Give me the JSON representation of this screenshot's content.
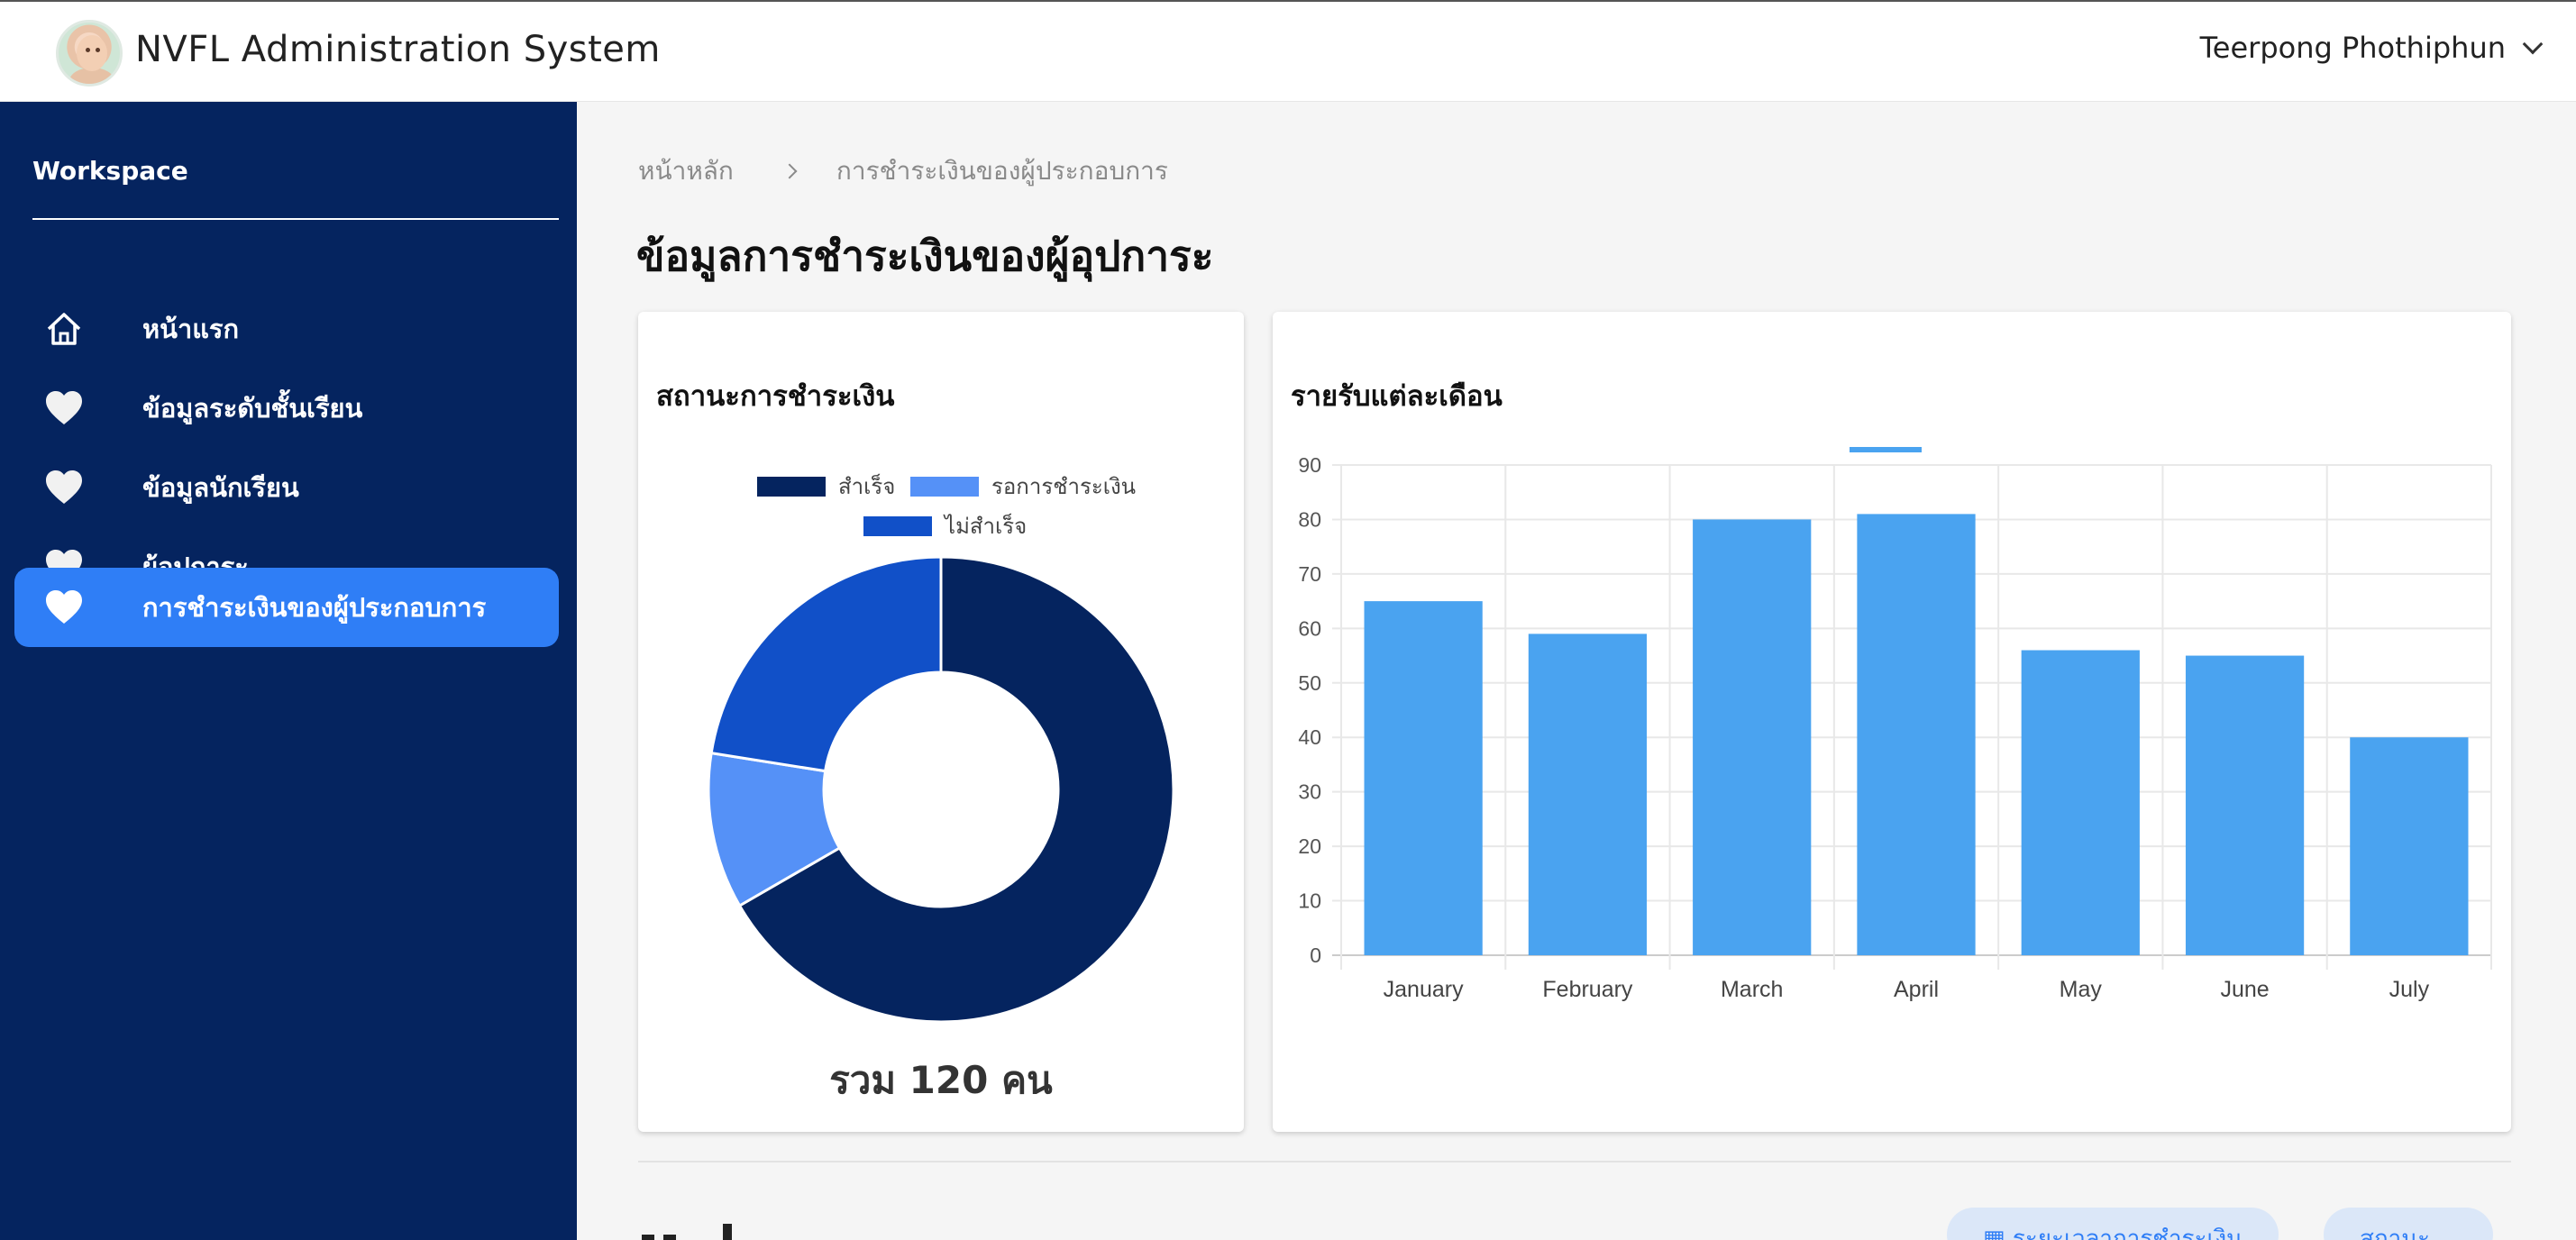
{
  "header": {
    "app_title": "NVFL Administration System",
    "user_name": "Teerpong Phothiphun"
  },
  "sidebar": {
    "workspace_label": "Workspace",
    "items": [
      {
        "label": "หน้าแรก",
        "icon": "home-icon",
        "active": false
      },
      {
        "label": "ข้อมูลระดับชั้นเรียน",
        "icon": "heart-icon",
        "active": false
      },
      {
        "label": "ข้อมูลนักเรียน",
        "icon": "heart-icon",
        "active": false
      },
      {
        "label": "ผู้อุปการะ",
        "icon": "heart-icon",
        "active": false
      },
      {
        "label": "การชำระเงินของผู้ประกอบการ",
        "icon": "heart-icon",
        "active": true
      }
    ],
    "colors": {
      "background": "#05245f",
      "active": "#2f7ef6"
    }
  },
  "breadcrumb": {
    "home": "หน้าหลัก",
    "current": "การชำระเงินของผู้ประกอบการ"
  },
  "page": {
    "title": "ข้อมูลการชำระเงินของผู้อุปการะ"
  },
  "status_card": {
    "title": "สถานะการชำระเงิน",
    "total_label": "รวม 120 คน"
  },
  "revenue_card": {
    "title": "รายรับแต่ละเดือน"
  },
  "bottom_pills": {
    "first": "ระยะเวลาการชำระเงิน",
    "second": "สถานะ"
  },
  "chart_data": [
    {
      "type": "pie",
      "variant": "doughnut",
      "labels": [
        "สำเร็จ",
        "รอการชำระเงิน",
        "ไม่สำเร็จ"
      ],
      "values": [
        80,
        13,
        27
      ],
      "colors": [
        "#05245f",
        "#5591f7",
        "#1150c8"
      ],
      "legend": "top"
    },
    {
      "type": "bar",
      "categories": [
        "January",
        "February",
        "March",
        "April",
        "May",
        "June",
        "July"
      ],
      "values": [
        65,
        59,
        80,
        81,
        56,
        55,
        40
      ],
      "ylim": [
        0,
        90
      ],
      "yticks": [
        0,
        10,
        20,
        30,
        40,
        50,
        60,
        70,
        80,
        90
      ],
      "color": "#4aa3f0",
      "grid": true,
      "legend": "top"
    }
  ]
}
